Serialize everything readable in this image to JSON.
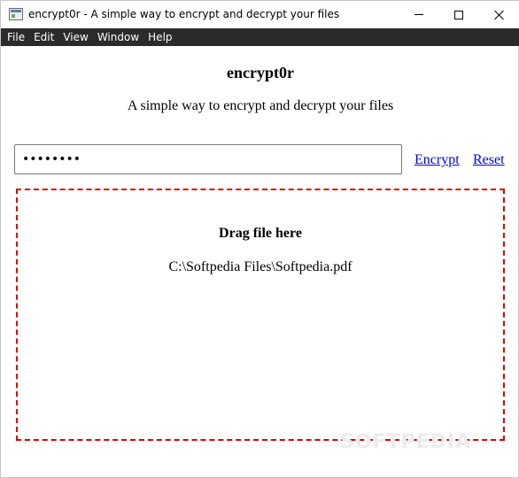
{
  "window": {
    "title": "encrypt0r - A simple way to encrypt and decrypt your files",
    "controls": [
      "minimize",
      "maximize",
      "close"
    ]
  },
  "menu": {
    "items": [
      "File",
      "Edit",
      "View",
      "Window",
      "Help"
    ]
  },
  "main": {
    "heading": "encrypt0r",
    "subheading": "A simple way to encrypt and decrypt your files",
    "password_value": "••••••••",
    "encrypt_label": "Encrypt",
    "reset_label": "Reset"
  },
  "dropzone": {
    "title": "Drag file here",
    "file_path": "C:\\Softpedia Files\\Softpedia.pdf",
    "border_color": "#e00000"
  },
  "watermark": "SOFTPEDIA"
}
